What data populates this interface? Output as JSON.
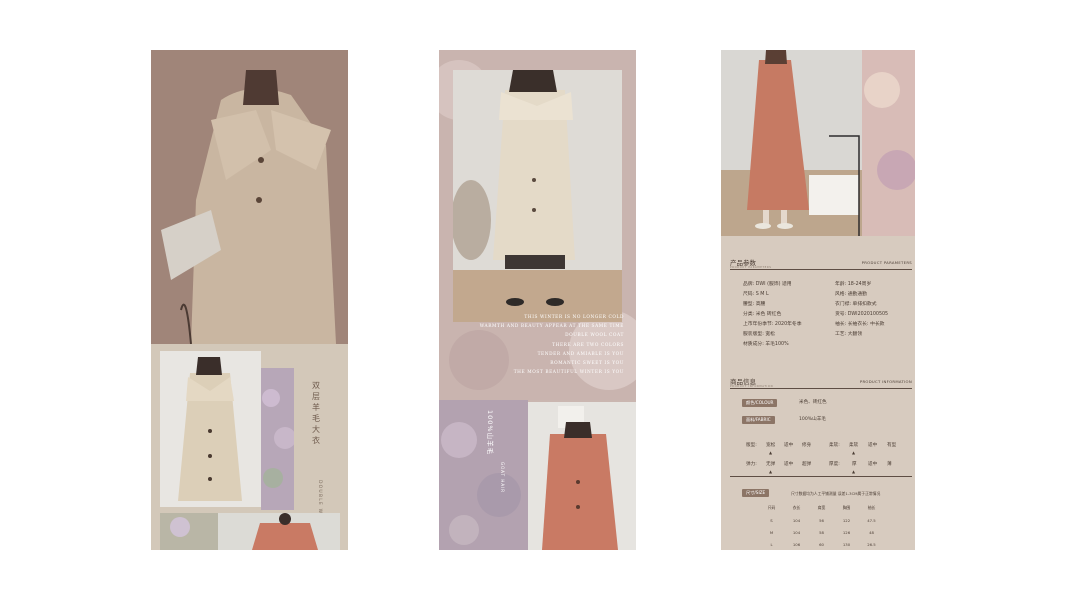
{
  "panel1": {
    "title_vertical": "双层羊毛大衣",
    "subtitle_vertical": "DOUBLE WOOL COAT"
  },
  "panel2": {
    "poem_lines": [
      "THIS WINTER IS NO LONGER COLD",
      "WARMTH AND BEAUTY APPEAR AT THE SAME TIME",
      "DOUBLE WOOL COAT",
      "THERE ARE TWO COLORS",
      "TENDER AND AMIABLE IS YOU",
      "ROMANTIC SWEET IS YOU",
      "THE MOST BEAUTIFUL WINTER IS YOU"
    ],
    "vertical_title": "100%山羊毛",
    "vertical_sub": "GOAT HAIR"
  },
  "panel3": {
    "params": {
      "title": "产品参数",
      "subtitle": "PRODUCT PARAMETERS",
      "en": "PRODUCT PARAMETERS",
      "left": [
        "品牌: DWI (服饰) 适用",
        "尺码: S M L",
        "腰型: 高腰",
        "分类: 米色 砖红色",
        "上市年份季节: 2020年冬季",
        "服装版型: 宽松",
        "材质成分: 羊毛100%"
      ],
      "right": [
        "年龄: 18-24周岁",
        "风格: 通勤通勤",
        "衣门襟: 单排扣款式",
        "货号: DWI2020100505",
        "袖长: 长袖衣长: 中长款",
        "工艺: 大翻领"
      ]
    },
    "info": {
      "title": "商品信息",
      "subtitle": "PRODUCT INFORMATION",
      "en": "PRODUCT INFORMATION",
      "colour_label": "颜色/COLOUR",
      "colour_value": "米色、砖红色",
      "fabric_label": "面料/FABRIC",
      "fabric_value": "100%山羊毛",
      "rows": [
        {
          "a_label": "版型:",
          "a_opts": [
            "宽松",
            "适中",
            "修身"
          ],
          "b_label": "柔软:",
          "b_opts": [
            "柔软",
            "适中",
            "有型"
          ]
        },
        {
          "a_label": "弹力:",
          "a_opts": [
            "无弹",
            "适中",
            "超弹"
          ],
          "b_label": "厚度:",
          "b_opts": [
            "厚",
            "适中",
            "薄"
          ]
        }
      ],
      "marker": "▲"
    },
    "size": {
      "label": "尺寸/SIZE",
      "note": "尺寸数据均为人工平铺测量 误差1-3CM属于正常情况",
      "headers": [
        "尺码",
        "衣长",
        "肩宽",
        "胸围",
        "袖长"
      ],
      "rows": [
        [
          "S",
          "104",
          "56",
          "122",
          "47.5"
        ],
        [
          "M",
          "104",
          "58",
          "126",
          "48"
        ],
        [
          "L",
          "106",
          "60",
          "130",
          "26.5"
        ]
      ]
    }
  },
  "colors": {
    "panel_bg_1": "#d3c8b9",
    "panel_bg_2": "#cab6b0",
    "panel_bg_3": "#d7cbbf",
    "accent_brown": "#8c7566",
    "coat_cream": "#e7dccb",
    "coat_terracotta": "#c97a64"
  }
}
